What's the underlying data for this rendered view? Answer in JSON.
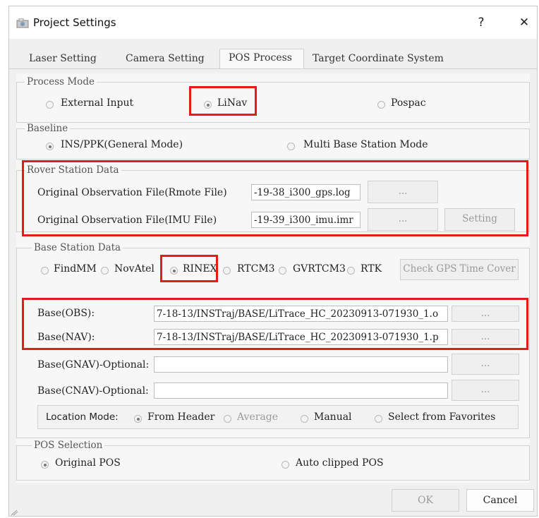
{
  "window": {
    "title": "Project Settings",
    "help_label": "?",
    "close_label": "✕"
  },
  "tabs": [
    "Laser Setting",
    "Camera Setting",
    "POS Process",
    "Target Coordinate System"
  ],
  "process_mode": {
    "legend": "Process Mode",
    "options": [
      "External Input",
      "LiNav",
      "Pospac"
    ],
    "selected": "LiNav"
  },
  "baseline": {
    "legend": "Baseline",
    "options": [
      "INS/PPK(General Mode)",
      "Multi Base Station  Mode"
    ],
    "selected": "INS/PPK(General Mode)"
  },
  "rover": {
    "legend": "Rover Station Data",
    "obs_label": "Original Observation File(Rmote File)",
    "obs_value": "-19-38_i300_gps.log",
    "imu_label": "Original Observation File(IMU File)",
    "imu_value": "-19-39_i300_imu.imr",
    "browse_label": "...",
    "setting_label": "Setting"
  },
  "base_station": {
    "legend": "Base Station Data",
    "formats": [
      "FindMM",
      "NovAtel",
      "RINEX",
      "RTCM3",
      "GVRTCM3",
      "RTK"
    ],
    "selected": "RINEX",
    "check_label": "Check GPS Time Cover",
    "obs_label": "Base(OBS):",
    "obs_value": "7-18-13/INSTraj/BASE/LiTrace_HC_20230913-071930_1.o",
    "nav_label": "Base(NAV):",
    "nav_value": "7-18-13/INSTraj/BASE/LiTrace_HC_20230913-071930_1.p",
    "gnav_label": "Base(GNAV)-Optional:",
    "gnav_value": "",
    "cnav_label": "Base(CNAV)-Optional:",
    "cnav_value": "",
    "browse_label": "...",
    "location_mode_label": "Location Mode:",
    "location_options": [
      "From Header",
      "Average",
      "Manual",
      "Select from Favorites"
    ],
    "location_selected": "From Header"
  },
  "pos_selection": {
    "legend": "POS Selection",
    "options": [
      "Original POS",
      "Auto clipped POS"
    ],
    "selected": "Original POS"
  },
  "footer": {
    "ok_label": "OK",
    "cancel_label": "Cancel"
  },
  "colors": {
    "highlight": "#e41b1b",
    "dialog_bg": "#f0f0f0"
  }
}
